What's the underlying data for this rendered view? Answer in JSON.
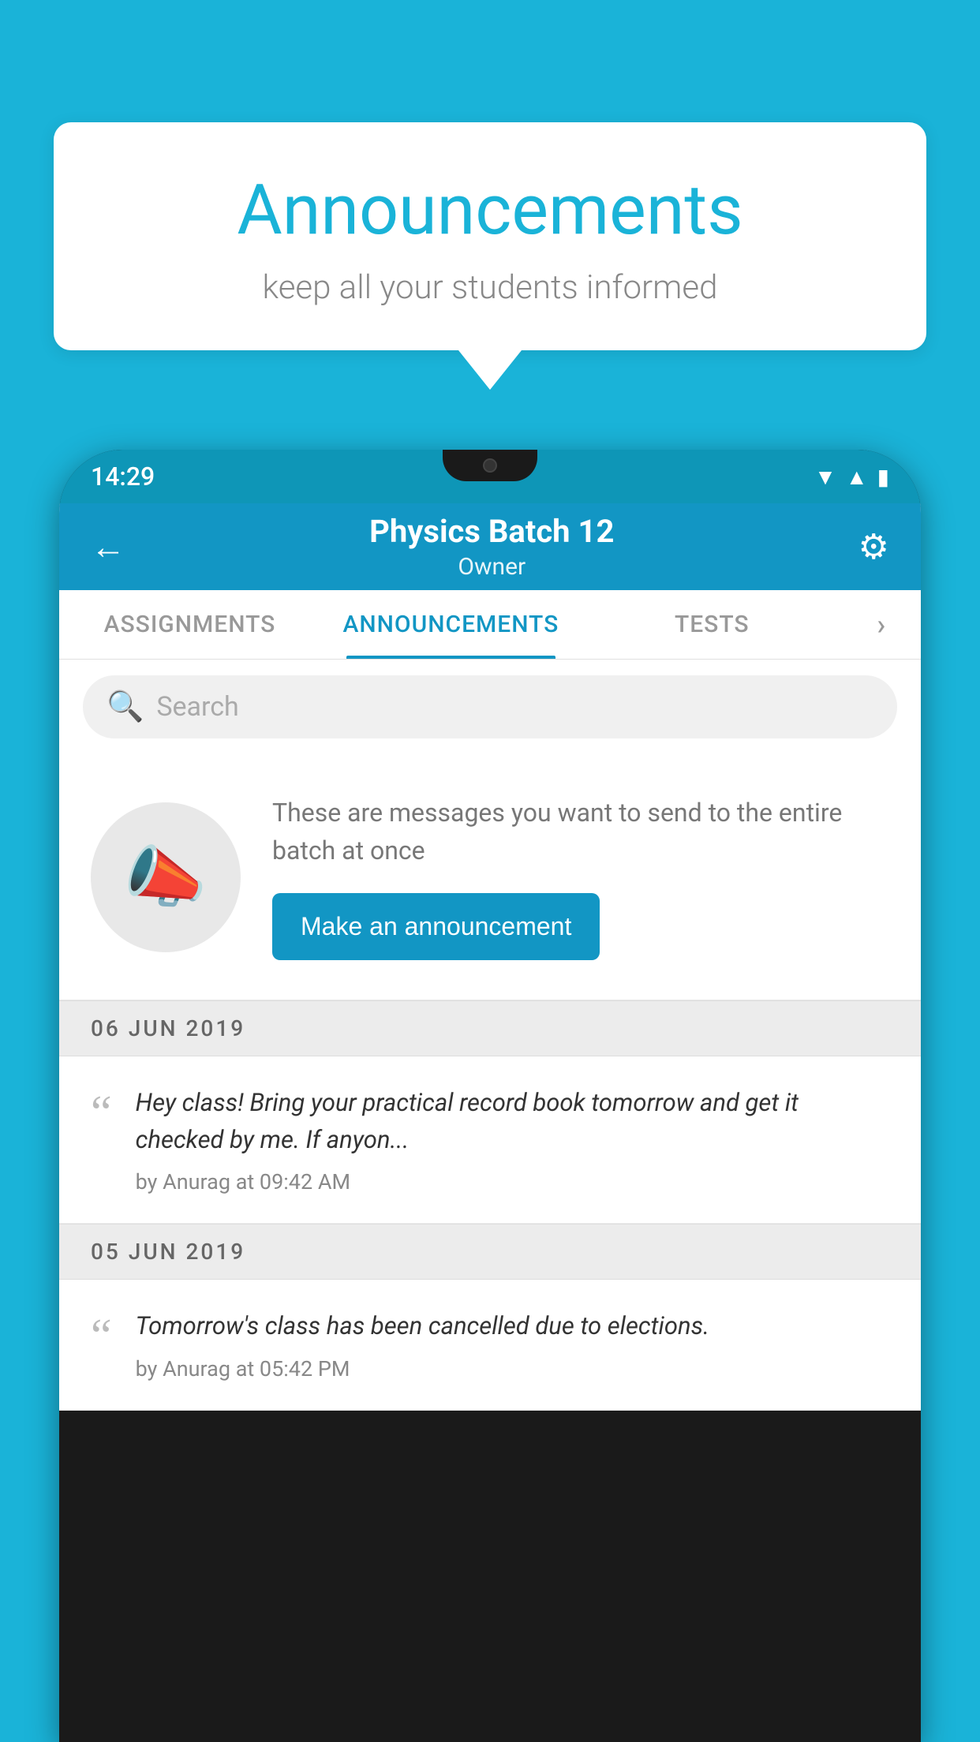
{
  "background_color": "#1ab3d8",
  "speech_bubble": {
    "title": "Announcements",
    "subtitle": "keep all your students informed"
  },
  "phone": {
    "status_bar": {
      "time": "14:29",
      "icons": [
        "wifi",
        "signal",
        "battery"
      ]
    },
    "header": {
      "title": "Physics Batch 12",
      "subtitle": "Owner",
      "back_label": "←",
      "gear_label": "⚙"
    },
    "tabs": [
      {
        "label": "ASSIGNMENTS",
        "active": false
      },
      {
        "label": "ANNOUNCEMENTS",
        "active": true
      },
      {
        "label": "TESTS",
        "active": false
      },
      {
        "label": "›",
        "active": false
      }
    ],
    "search": {
      "placeholder": "Search"
    },
    "promo": {
      "description": "These are messages you want to send to the entire batch at once",
      "button_label": "Make an announcement",
      "icon": "📣"
    },
    "announcements": [
      {
        "date": "06  JUN  2019",
        "text": "Hey class! Bring your practical record book tomorrow and get it checked by me. If anyon...",
        "meta": "by Anurag at 09:42 AM"
      },
      {
        "date": "05  JUN  2019",
        "text": "Tomorrow's class has been cancelled due to elections.",
        "meta": "by Anurag at 05:42 PM"
      }
    ]
  }
}
